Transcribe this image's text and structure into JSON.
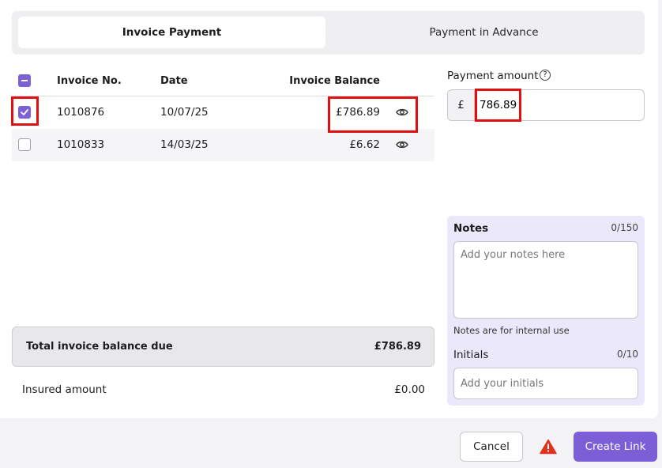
{
  "tabs": [
    {
      "label": "Invoice Payment",
      "active": true
    },
    {
      "label": "Payment in Advance",
      "active": false
    }
  ],
  "table": {
    "headers": {
      "invoice_no": "Invoice No.",
      "date": "Date",
      "balance": "Invoice Balance"
    },
    "rows": [
      {
        "checked": true,
        "invoice_no": "1010876",
        "date": "10/07/25",
        "balance": "£786.89",
        "icon": "eye-icon"
      },
      {
        "checked": false,
        "invoice_no": "1010833",
        "date": "14/03/25",
        "balance": "£6.62",
        "icon": "eye-icon"
      }
    ]
  },
  "totals": {
    "label": "Total invoice balance due",
    "value": "£786.89"
  },
  "insured": {
    "label": "Insured amount",
    "value": "£0.00"
  },
  "payment": {
    "label": "Payment amount",
    "help_icon": "help-circle-icon",
    "currency": "£",
    "value": "786.89"
  },
  "notes": {
    "label": "Notes",
    "count": "0/150",
    "placeholder": "Add your notes here",
    "hint": "Notes are for internal use"
  },
  "initials": {
    "label": "Initials",
    "count": "0/10",
    "placeholder": "Add your initials"
  },
  "footer": {
    "cancel": "Cancel",
    "create": "Create Link",
    "warning_icon": "warning-triangle-icon"
  },
  "colors": {
    "accent": "#7c5fd6",
    "highlight": "#e01010",
    "notes_bg": "#ebe8fb",
    "warning": "#e0321e"
  }
}
